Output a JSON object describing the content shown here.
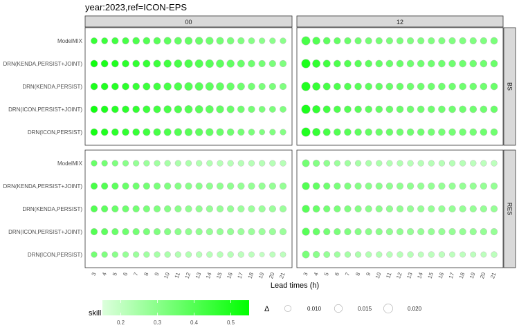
{
  "chart_data": {
    "type": "scatter",
    "title": "year:2023,ref=ICON-EPS",
    "xlabel": "Lead times (h)",
    "ylabel": "",
    "x": [
      "3",
      "4",
      "5",
      "6",
      "7",
      "8",
      "9",
      "10",
      "11",
      "12",
      "13",
      "14",
      "15",
      "16",
      "17",
      "18",
      "19",
      "20",
      "21"
    ],
    "facet_cols": [
      "00",
      "12"
    ],
    "facet_rows": [
      "BS",
      "RES"
    ],
    "models": [
      "ModelMIX",
      "DRN(KENDA,PERSIST+JOINT)",
      "DRN(KENDA,PERSIST)",
      "DRN(ICON,PERSIST+JOINT)",
      "DRN(ICON,PERSIST)"
    ],
    "legend": {
      "fill_title": "skill",
      "fill_ticks": [
        0.2,
        0.3,
        0.4,
        0.5
      ],
      "fill_range": [
        0.15,
        0.55
      ],
      "fill_low_color": "#ddffdd",
      "fill_high_color": "#00ff00",
      "size_title": "Δ",
      "size_ticks": [
        0.01,
        0.015,
        0.02
      ],
      "size_tick_labels": [
        "0.010",
        "0.015",
        "0.020"
      ]
    },
    "panels": [
      {
        "row": "BS",
        "col": "00",
        "series": [
          {
            "name": "ModelMIX",
            "skill": [
              0.45,
              0.44,
              0.43,
              0.42,
              0.41,
              0.4,
              0.39,
              0.38,
              0.37,
              0.37,
              0.36,
              0.35,
              0.34,
              0.33,
              0.32,
              0.31,
              0.3,
              0.3,
              0.3
            ],
            "delta": [
              0.01,
              0.01,
              0.011,
              0.011,
              0.012,
              0.012,
              0.012,
              0.013,
              0.013,
              0.014,
              0.014,
              0.014,
              0.013,
              0.012,
              0.011,
              0.01,
              0.009,
              0.009,
              0.009
            ]
          },
          {
            "name": "DRN(KENDA,PERSIST+JOINT)",
            "skill": [
              0.52,
              0.5,
              0.49,
              0.47,
              0.46,
              0.45,
              0.44,
              0.43,
              0.42,
              0.41,
              0.4,
              0.39,
              0.38,
              0.37,
              0.36,
              0.35,
              0.34,
              0.33,
              0.32
            ],
            "delta": [
              0.012,
              0.012,
              0.012,
              0.012,
              0.012,
              0.013,
              0.013,
              0.014,
              0.015,
              0.016,
              0.016,
              0.016,
              0.015,
              0.014,
              0.013,
              0.012,
              0.011,
              0.011,
              0.011
            ]
          },
          {
            "name": "DRN(KENDA,PERSIST)",
            "skill": [
              0.5,
              0.49,
              0.48,
              0.47,
              0.45,
              0.44,
              0.43,
              0.42,
              0.41,
              0.4,
              0.39,
              0.38,
              0.37,
              0.36,
              0.35,
              0.34,
              0.33,
              0.33,
              0.32
            ],
            "delta": [
              0.012,
              0.012,
              0.012,
              0.012,
              0.012,
              0.013,
              0.013,
              0.014,
              0.015,
              0.016,
              0.016,
              0.016,
              0.015,
              0.014,
              0.013,
              0.012,
              0.011,
              0.011,
              0.011
            ]
          },
          {
            "name": "DRN(ICON,PERSIST+JOINT)",
            "skill": [
              0.52,
              0.5,
              0.48,
              0.47,
              0.46,
              0.44,
              0.43,
              0.42,
              0.41,
              0.4,
              0.39,
              0.38,
              0.37,
              0.36,
              0.35,
              0.34,
              0.33,
              0.33,
              0.32
            ],
            "delta": [
              0.012,
              0.012,
              0.012,
              0.012,
              0.012,
              0.013,
              0.013,
              0.014,
              0.014,
              0.015,
              0.015,
              0.015,
              0.014,
              0.013,
              0.012,
              0.011,
              0.01,
              0.01,
              0.01
            ]
          },
          {
            "name": "DRN(ICON,PERSIST)",
            "skill": [
              0.51,
              0.49,
              0.47,
              0.46,
              0.45,
              0.43,
              0.42,
              0.41,
              0.4,
              0.39,
              0.38,
              0.37,
              0.36,
              0.35,
              0.34,
              0.33,
              0.32,
              0.32,
              0.31
            ],
            "delta": [
              0.012,
              0.012,
              0.012,
              0.012,
              0.012,
              0.013,
              0.013,
              0.013,
              0.014,
              0.014,
              0.014,
              0.014,
              0.013,
              0.012,
              0.011,
              0.01,
              0.008,
              0.009,
              0.009
            ]
          }
        ]
      },
      {
        "row": "BS",
        "col": "12",
        "series": [
          {
            "name": "ModelMIX",
            "skill": [
              0.42,
              0.4,
              0.38,
              0.37,
              0.36,
              0.35,
              0.34,
              0.34,
              0.33,
              0.33,
              0.32,
              0.32,
              0.32,
              0.32,
              0.32,
              0.32,
              0.32,
              0.32,
              0.33
            ],
            "delta": [
              0.018,
              0.014,
              0.012,
              0.011,
              0.011,
              0.011,
              0.011,
              0.011,
              0.011,
              0.011,
              0.011,
              0.011,
              0.011,
              0.011,
              0.011,
              0.011,
              0.011,
              0.011,
              0.012
            ]
          },
          {
            "name": "DRN(KENDA,PERSIST+JOINT)",
            "skill": [
              0.5,
              0.46,
              0.43,
              0.41,
              0.4,
              0.39,
              0.38,
              0.37,
              0.36,
              0.36,
              0.35,
              0.35,
              0.35,
              0.35,
              0.35,
              0.35,
              0.35,
              0.35,
              0.36
            ],
            "delta": [
              0.019,
              0.015,
              0.013,
              0.012,
              0.012,
              0.012,
              0.012,
              0.012,
              0.012,
              0.012,
              0.012,
              0.012,
              0.012,
              0.012,
              0.012,
              0.012,
              0.012,
              0.012,
              0.012
            ]
          },
          {
            "name": "DRN(KENDA,PERSIST)",
            "skill": [
              0.49,
              0.45,
              0.42,
              0.41,
              0.4,
              0.39,
              0.38,
              0.37,
              0.36,
              0.36,
              0.35,
              0.35,
              0.35,
              0.35,
              0.35,
              0.35,
              0.35,
              0.35,
              0.36
            ],
            "delta": [
              0.019,
              0.015,
              0.013,
              0.012,
              0.012,
              0.012,
              0.012,
              0.012,
              0.012,
              0.012,
              0.012,
              0.012,
              0.012,
              0.012,
              0.012,
              0.012,
              0.012,
              0.012,
              0.012
            ]
          },
          {
            "name": "DRN(ICON,PERSIST+JOINT)",
            "skill": [
              0.5,
              0.46,
              0.43,
              0.41,
              0.4,
              0.39,
              0.38,
              0.37,
              0.36,
              0.36,
              0.35,
              0.35,
              0.35,
              0.35,
              0.35,
              0.35,
              0.35,
              0.35,
              0.36
            ],
            "delta": [
              0.019,
              0.015,
              0.013,
              0.012,
              0.012,
              0.012,
              0.012,
              0.012,
              0.012,
              0.012,
              0.012,
              0.012,
              0.012,
              0.012,
              0.012,
              0.012,
              0.012,
              0.012,
              0.012
            ]
          },
          {
            "name": "DRN(ICON,PERSIST)",
            "skill": [
              0.49,
              0.45,
              0.42,
              0.4,
              0.39,
              0.38,
              0.37,
              0.36,
              0.36,
              0.35,
              0.35,
              0.35,
              0.34,
              0.34,
              0.34,
              0.34,
              0.34,
              0.35,
              0.35
            ],
            "delta": [
              0.019,
              0.015,
              0.013,
              0.012,
              0.012,
              0.012,
              0.012,
              0.012,
              0.012,
              0.012,
              0.012,
              0.012,
              0.012,
              0.012,
              0.012,
              0.012,
              0.012,
              0.012,
              0.012
            ]
          }
        ]
      },
      {
        "row": "RES",
        "col": "00",
        "series": [
          {
            "name": "ModelMIX",
            "skill": [
              0.36,
              0.34,
              0.32,
              0.3,
              0.28,
              0.27,
              0.26,
              0.25,
              0.24,
              0.24,
              0.23,
              0.23,
              0.22,
              0.22,
              0.22,
              0.22,
              0.22,
              0.22,
              0.22
            ],
            "delta": [
              0.009,
              0.009,
              0.009,
              0.009,
              0.009,
              0.009,
              0.009,
              0.009,
              0.009,
              0.009,
              0.009,
              0.009,
              0.009,
              0.009,
              0.009,
              0.009,
              0.009,
              0.009,
              0.009
            ]
          },
          {
            "name": "DRN(KENDA,PERSIST+JOINT)",
            "skill": [
              0.42,
              0.4,
              0.38,
              0.36,
              0.35,
              0.34,
              0.33,
              0.32,
              0.31,
              0.3,
              0.3,
              0.29,
              0.29,
              0.29,
              0.28,
              0.28,
              0.28,
              0.28,
              0.28
            ],
            "delta": [
              0.011,
              0.011,
              0.011,
              0.011,
              0.011,
              0.011,
              0.011,
              0.011,
              0.011,
              0.011,
              0.011,
              0.011,
              0.011,
              0.011,
              0.011,
              0.011,
              0.011,
              0.011,
              0.011
            ]
          },
          {
            "name": "DRN(KENDA,PERSIST)",
            "skill": [
              0.4,
              0.38,
              0.36,
              0.35,
              0.34,
              0.33,
              0.32,
              0.31,
              0.3,
              0.29,
              0.29,
              0.28,
              0.28,
              0.28,
              0.27,
              0.27,
              0.27,
              0.27,
              0.27
            ],
            "delta": [
              0.011,
              0.011,
              0.011,
              0.011,
              0.011,
              0.011,
              0.011,
              0.011,
              0.011,
              0.011,
              0.011,
              0.011,
              0.011,
              0.011,
              0.011,
              0.011,
              0.011,
              0.011,
              0.011
            ]
          },
          {
            "name": "DRN(ICON,PERSIST+JOINT)",
            "skill": [
              0.4,
              0.38,
              0.36,
              0.35,
              0.34,
              0.33,
              0.32,
              0.31,
              0.3,
              0.29,
              0.29,
              0.28,
              0.28,
              0.28,
              0.27,
              0.27,
              0.27,
              0.27,
              0.27
            ],
            "delta": [
              0.011,
              0.011,
              0.011,
              0.011,
              0.011,
              0.011,
              0.011,
              0.011,
              0.011,
              0.011,
              0.011,
              0.011,
              0.011,
              0.011,
              0.011,
              0.011,
              0.011,
              0.011,
              0.011
            ]
          },
          {
            "name": "DRN(ICON,PERSIST)",
            "skill": [
              0.34,
              0.32,
              0.3,
              0.28,
              0.27,
              0.26,
              0.25,
              0.24,
              0.23,
              0.23,
              0.22,
              0.22,
              0.22,
              0.22,
              0.21,
              0.21,
              0.2,
              0.21,
              0.21
            ],
            "delta": [
              0.009,
              0.009,
              0.009,
              0.009,
              0.009,
              0.009,
              0.009,
              0.009,
              0.009,
              0.009,
              0.009,
              0.009,
              0.009,
              0.009,
              0.009,
              0.008,
              0.006,
              0.008,
              0.008
            ]
          }
        ]
      },
      {
        "row": "RES",
        "col": "12",
        "series": [
          {
            "name": "ModelMIX",
            "skill": [
              0.34,
              0.31,
              0.29,
              0.27,
              0.26,
              0.25,
              0.24,
              0.24,
              0.23,
              0.23,
              0.22,
              0.22,
              0.22,
              0.22,
              0.22,
              0.22,
              0.21,
              0.21,
              0.21
            ],
            "delta": [
              0.013,
              0.011,
              0.01,
              0.009,
              0.009,
              0.009,
              0.009,
              0.009,
              0.009,
              0.009,
              0.009,
              0.009,
              0.009,
              0.009,
              0.009,
              0.009,
              0.009,
              0.009,
              0.009
            ]
          },
          {
            "name": "DRN(KENDA,PERSIST+JOINT)",
            "skill": [
              0.4,
              0.37,
              0.35,
              0.33,
              0.32,
              0.31,
              0.3,
              0.3,
              0.29,
              0.29,
              0.29,
              0.28,
              0.28,
              0.28,
              0.28,
              0.28,
              0.28,
              0.28,
              0.28
            ],
            "delta": [
              0.014,
              0.012,
              0.011,
              0.011,
              0.011,
              0.011,
              0.011,
              0.011,
              0.011,
              0.011,
              0.011,
              0.011,
              0.011,
              0.011,
              0.011,
              0.011,
              0.011,
              0.011,
              0.011
            ]
          },
          {
            "name": "DRN(KENDA,PERSIST)",
            "skill": [
              0.39,
              0.36,
              0.34,
              0.33,
              0.32,
              0.31,
              0.3,
              0.3,
              0.29,
              0.29,
              0.28,
              0.28,
              0.28,
              0.28,
              0.28,
              0.28,
              0.28,
              0.28,
              0.28
            ],
            "delta": [
              0.014,
              0.012,
              0.011,
              0.011,
              0.011,
              0.011,
              0.011,
              0.011,
              0.011,
              0.011,
              0.011,
              0.011,
              0.011,
              0.011,
              0.011,
              0.011,
              0.011,
              0.011,
              0.011
            ]
          },
          {
            "name": "DRN(ICON,PERSIST+JOINT)",
            "skill": [
              0.39,
              0.36,
              0.34,
              0.33,
              0.32,
              0.31,
              0.3,
              0.3,
              0.29,
              0.29,
              0.28,
              0.28,
              0.28,
              0.28,
              0.28,
              0.28,
              0.28,
              0.28,
              0.28
            ],
            "delta": [
              0.014,
              0.012,
              0.011,
              0.011,
              0.011,
              0.011,
              0.011,
              0.011,
              0.011,
              0.011,
              0.011,
              0.011,
              0.011,
              0.011,
              0.011,
              0.011,
              0.011,
              0.011,
              0.011
            ]
          },
          {
            "name": "DRN(ICON,PERSIST)",
            "skill": [
              0.33,
              0.3,
              0.28,
              0.26,
              0.25,
              0.24,
              0.23,
              0.23,
              0.22,
              0.22,
              0.22,
              0.21,
              0.21,
              0.21,
              0.21,
              0.21,
              0.21,
              0.21,
              0.21
            ],
            "delta": [
              0.013,
              0.011,
              0.01,
              0.009,
              0.009,
              0.009,
              0.009,
              0.009,
              0.009,
              0.009,
              0.009,
              0.008,
              0.009,
              0.009,
              0.008,
              0.008,
              0.008,
              0.008,
              0.009
            ]
          }
        ]
      }
    ]
  }
}
